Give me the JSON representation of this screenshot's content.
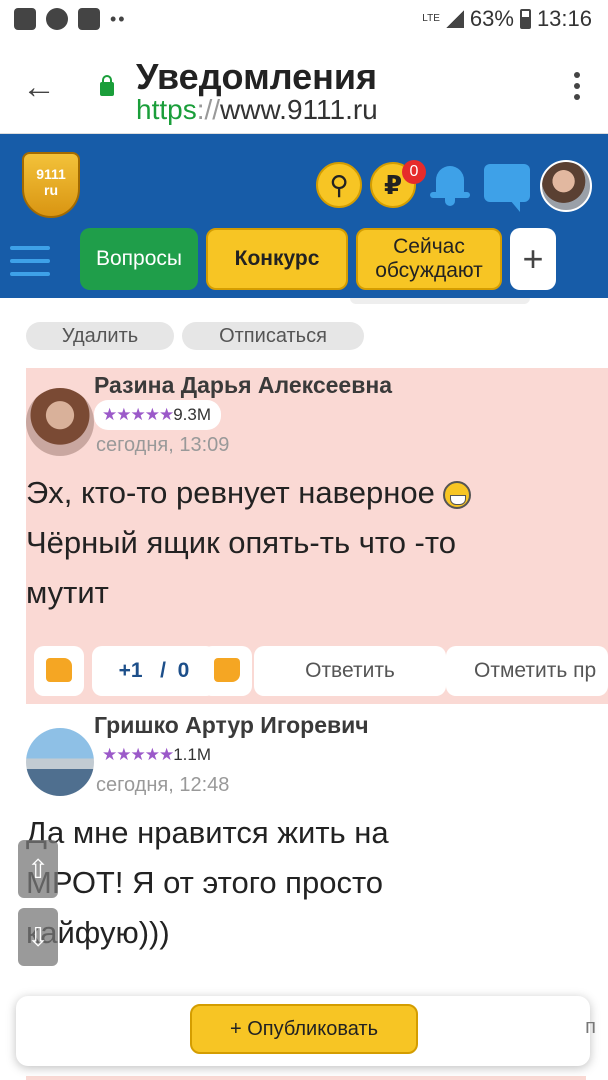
{
  "statusbar": {
    "network": "LTE",
    "battery": "63%",
    "time": "13:16"
  },
  "browser": {
    "title": "Уведомления",
    "url_scheme": "https",
    "url_sep": "://",
    "url_host": "www.9111.ru"
  },
  "site": {
    "logo_text": "9111",
    "logo_sub": "ru",
    "wallet_symbol": "₽",
    "wallet_badge": "0",
    "tabs": {
      "questions": "Вопросы",
      "contest": "Конкурс",
      "now_1": "Сейчас",
      "now_2": "обсуждают",
      "plus": "+"
    }
  },
  "notification_actions": {
    "delete": "Удалить",
    "unsubscribe": "Отписаться"
  },
  "comments": [
    {
      "author": "Разина Дарья Алексеевна",
      "stars": "★★★★★",
      "rating": "9.3M",
      "time": "сегодня, 13:09",
      "text_line1": "Эх, кто-то ревнует наверное",
      "text_line2": "Чёрный ящик опять-ть что -то",
      "text_line3": "мутит",
      "votes_plus": "+1",
      "votes_sep": "/",
      "votes_minus": "0",
      "reply": "Ответить",
      "mark": "Отметить пр"
    },
    {
      "author": "Гришко Артур Игоревич",
      "stars": "★★★★★",
      "rating": "1.1M",
      "time": "сегодня, 12:48",
      "text_line1": "Да мне нравится жить на",
      "text_line2": "МРОТ! Я от этого просто",
      "text_line3": "кайфую)))"
    }
  ],
  "publish": {
    "label": "+ Опубликовать",
    "edge_text": "п"
  },
  "colors": {
    "header_blue": "#175ca8",
    "accent_yellow": "#f7c524",
    "green": "#1f9e4a",
    "highlight": "#fad9d4"
  }
}
